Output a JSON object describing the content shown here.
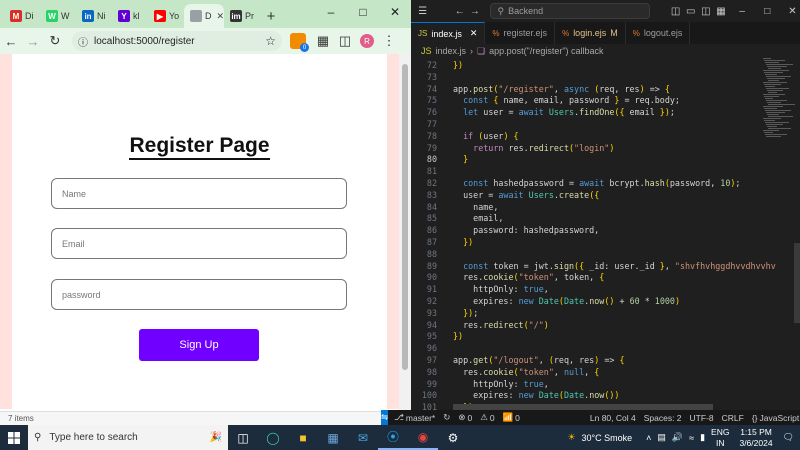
{
  "chrome": {
    "tabs": [
      {
        "label": "Di",
        "icon": "gmail-icon",
        "color": "#d93025",
        "glyph": "M"
      },
      {
        "label": "W",
        "icon": "whatsapp-icon",
        "color": "#25d366",
        "glyph": "W"
      },
      {
        "label": "Ni",
        "icon": "linkedin-icon",
        "color": "#0a66c2",
        "glyph": "in"
      },
      {
        "label": "kl",
        "icon": "yahoo-icon",
        "color": "#6001d2",
        "glyph": "Y"
      },
      {
        "label": "Yo",
        "icon": "youtube-icon",
        "color": "#ff0000",
        "glyph": "▶"
      },
      {
        "label": "D",
        "icon": "page-icon",
        "color": "#9aa0a6",
        "glyph": "",
        "active": true
      },
      {
        "label": "Pr",
        "icon": "imdb-icon",
        "color": "#333333",
        "glyph": "im"
      }
    ],
    "new_tab": "+",
    "url": "localhost:5000/register",
    "profile_initial": "R",
    "ext_badge": "0",
    "status_text": "7 items"
  },
  "page": {
    "title": "Register Page",
    "name_placeholder": "Name",
    "email_placeholder": "Email",
    "password_placeholder": "password",
    "submit_label": "Sign Up",
    "accent": "#7000ff"
  },
  "vscode": {
    "search": "Backend",
    "tabs": [
      {
        "label": "index.js",
        "icon": "JS",
        "active": true
      },
      {
        "label": "register.ejs",
        "icon": "%"
      },
      {
        "label": "login.ejs",
        "icon": "%",
        "modified": "M"
      },
      {
        "label": "logout.ejs",
        "icon": "%"
      }
    ],
    "breadcrumb": [
      "index.js",
      "app.post(\"/register\") callback"
    ],
    "active_line": 80,
    "status": {
      "branch": "master*",
      "errors": "0",
      "warnings": "0",
      "ports": "0",
      "position": "Ln 80, Col 4",
      "spaces": "Spaces: 2",
      "encoding": "UTF-8",
      "eol": "CRLF",
      "language": "JavaScript"
    }
  },
  "code": [
    {
      "n": "72",
      "t": "})"
    },
    {
      "n": "73",
      "t": ""
    },
    {
      "n": "74",
      "t": "app.post(\"/register\", async (req, res) => {"
    },
    {
      "n": "75",
      "t": "  const { name, email, password } = req.body;"
    },
    {
      "n": "76",
      "t": "  let user = await Users.findOne({ email });"
    },
    {
      "n": "77",
      "t": ""
    },
    {
      "n": "78",
      "t": "  if (user) {"
    },
    {
      "n": "79",
      "t": "    return res.redirect(\"login\")"
    },
    {
      "n": "80",
      "t": "  }"
    },
    {
      "n": "81",
      "t": ""
    },
    {
      "n": "82",
      "t": "  const hashedpassword = await bcrypt.hash(password, 10);"
    },
    {
      "n": "83",
      "t": "  user = await Users.create({"
    },
    {
      "n": "84",
      "t": "    name,"
    },
    {
      "n": "85",
      "t": "    email,"
    },
    {
      "n": "86",
      "t": "    password: hashedpassword,"
    },
    {
      "n": "87",
      "t": "  })"
    },
    {
      "n": "88",
      "t": ""
    },
    {
      "n": "89",
      "t": "  const token = jwt.sign({ _id: user._id }, \"shvfhvhggdhvvdhvvhv"
    },
    {
      "n": "90",
      "t": "  res.cookie(\"token\", token, {"
    },
    {
      "n": "91",
      "t": "    httpOnly: true,"
    },
    {
      "n": "92",
      "t": "    expires: new Date(Date.now() + 60 * 1000)"
    },
    {
      "n": "93",
      "t": "  });"
    },
    {
      "n": "94",
      "t": "  res.redirect(\"/\")"
    },
    {
      "n": "95",
      "t": "})"
    },
    {
      "n": "96",
      "t": ""
    },
    {
      "n": "97",
      "t": "app.get(\"/logout\", (req, res) => {"
    },
    {
      "n": "98",
      "t": "  res.cookie(\"token\", null, {"
    },
    {
      "n": "99",
      "t": "    httpOnly: true,"
    },
    {
      "n": "100",
      "t": "    expires: new Date(Date.now())"
    },
    {
      "n": "101",
      "t": "  });"
    }
  ],
  "taskbar": {
    "search_placeholder": "Type here to search",
    "weather": "30°C  Smoke",
    "lang": "ENG",
    "region": "IN",
    "time": "1:15 PM",
    "date": "3/6/2024"
  }
}
